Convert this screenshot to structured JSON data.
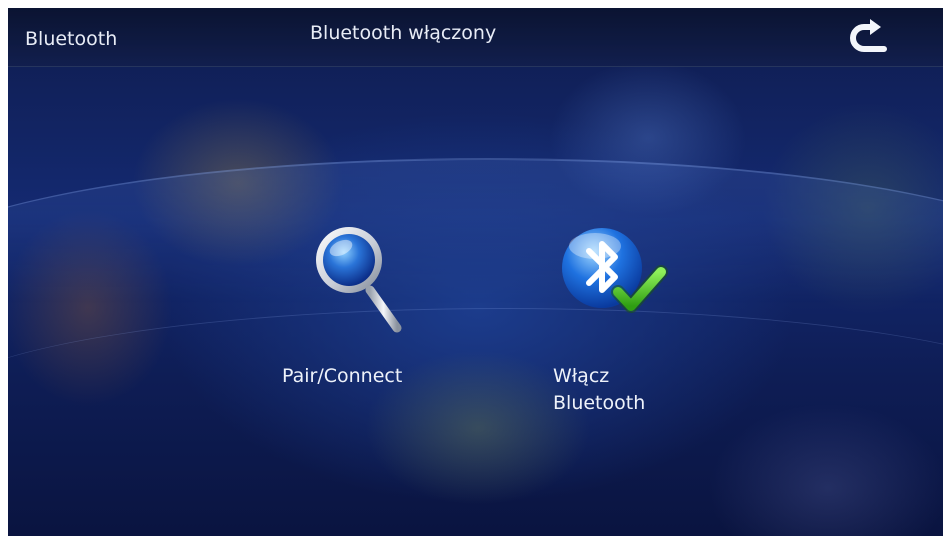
{
  "header": {
    "title": "Bluetooth",
    "status": "Bluetooth włączony",
    "back_icon": "back-arrow-icon"
  },
  "menu": {
    "items": [
      {
        "label": "Pair/Connect",
        "icon": "magnifier-icon"
      },
      {
        "label_line1": "Włącz",
        "label_line2": "Bluetooth",
        "icon": "bluetooth-check-icon"
      }
    ]
  },
  "colors": {
    "background": "#142a72",
    "text": "#e8ecf6",
    "accent_blue": "#1e6fe0",
    "check_green": "#4cc21e"
  }
}
